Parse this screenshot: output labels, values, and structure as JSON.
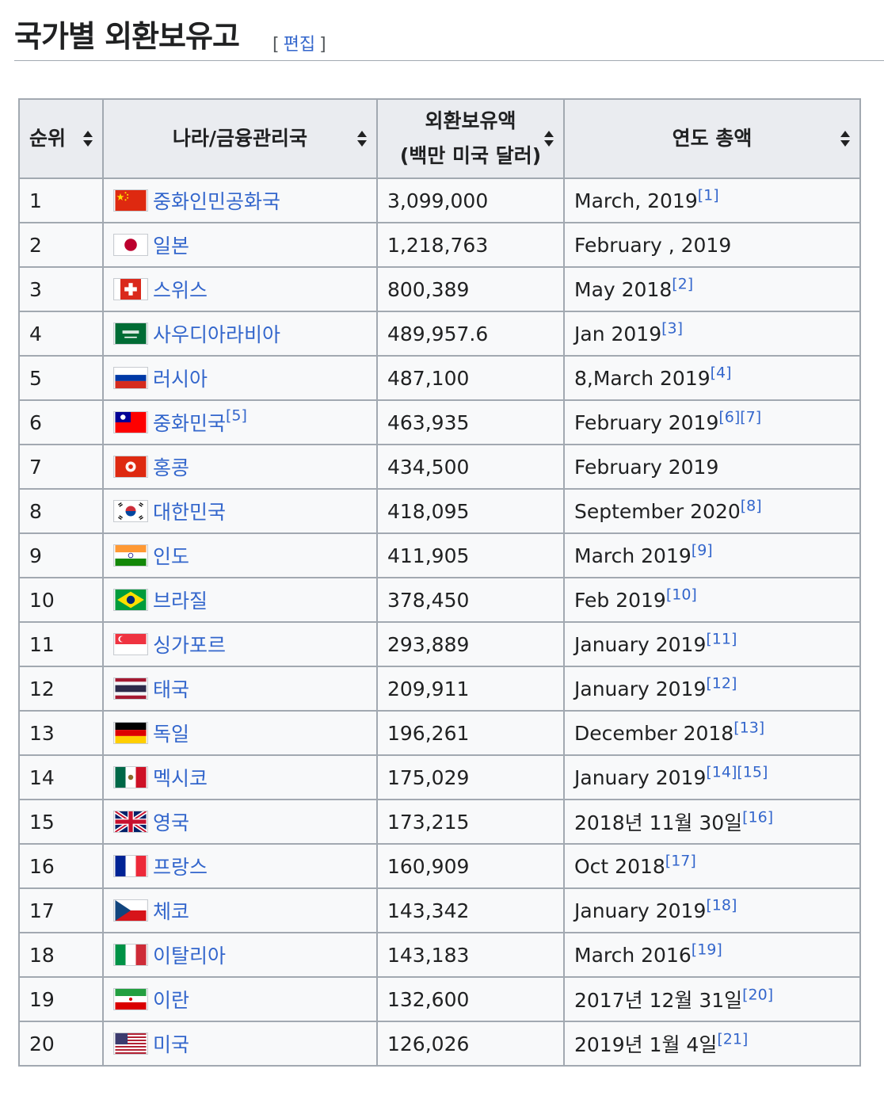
{
  "heading": {
    "title": "국가별 외환보유고",
    "edit_label": "편집",
    "bracket_open": "[",
    "bracket_close": "]"
  },
  "table": {
    "headers": [
      {
        "line1": "순위",
        "line2": ""
      },
      {
        "line1": "나라/금융관리국",
        "line2": ""
      },
      {
        "line1": "외환보유액",
        "line2": "(백만 미국 달러)"
      },
      {
        "line1": "연도 총액",
        "line2": ""
      }
    ],
    "rows": [
      {
        "rank": "1",
        "country": "중화인민공화국",
        "country_ref": "",
        "flag": "flag-china",
        "amount": "3,099,000",
        "date": "March, 2019",
        "refs": "[1]"
      },
      {
        "rank": "2",
        "country": "일본",
        "country_ref": "",
        "flag": "flag-japan",
        "amount": "1,218,763",
        "date": "February , 2019",
        "refs": ""
      },
      {
        "rank": "3",
        "country": "스위스",
        "country_ref": "",
        "flag": "flag-switzerland",
        "amount": "800,389",
        "date": "May 2018",
        "refs": "[2]"
      },
      {
        "rank": "4",
        "country": "사우디아라비아",
        "country_ref": "",
        "flag": "flag-saudi-arabia",
        "amount": "489,957.6",
        "date": "Jan 2019",
        "refs": "[3]"
      },
      {
        "rank": "5",
        "country": "러시아",
        "country_ref": "",
        "flag": "flag-russia",
        "amount": "487,100",
        "date": "8,March 2019",
        "refs": "[4]"
      },
      {
        "rank": "6",
        "country": "중화민국",
        "country_ref": "[5]",
        "flag": "flag-taiwan",
        "amount": "463,935",
        "date": "February 2019",
        "refs": "[6][7]"
      },
      {
        "rank": "7",
        "country": "홍콩",
        "country_ref": "",
        "flag": "flag-hong-kong",
        "amount": "434,500",
        "date": "February 2019",
        "refs": ""
      },
      {
        "rank": "8",
        "country": "대한민국",
        "country_ref": "",
        "flag": "flag-south-korea",
        "amount": "418,095",
        "date": "September 2020",
        "refs": "[8]"
      },
      {
        "rank": "9",
        "country": "인도",
        "country_ref": "",
        "flag": "flag-india",
        "amount": "411,905",
        "date": "March 2019",
        "refs": "[9]"
      },
      {
        "rank": "10",
        "country": "브라질",
        "country_ref": "",
        "flag": "flag-brazil",
        "amount": "378,450",
        "date": "Feb 2019",
        "refs": "[10]"
      },
      {
        "rank": "11",
        "country": "싱가포르",
        "country_ref": "",
        "flag": "flag-singapore",
        "amount": "293,889",
        "date": "January 2019",
        "refs": "[11]"
      },
      {
        "rank": "12",
        "country": "태국",
        "country_ref": "",
        "flag": "flag-thailand",
        "amount": "209,911",
        "date": "January 2019",
        "refs": "[12]"
      },
      {
        "rank": "13",
        "country": "독일",
        "country_ref": "",
        "flag": "flag-germany",
        "amount": "196,261",
        "date": "December 2018",
        "refs": "[13]"
      },
      {
        "rank": "14",
        "country": "멕시코",
        "country_ref": "",
        "flag": "flag-mexico",
        "amount": "175,029",
        "date": "January 2019",
        "refs": "[14][15]"
      },
      {
        "rank": "15",
        "country": "영국",
        "country_ref": "",
        "flag": "flag-united-kingdom",
        "amount": "173,215",
        "date": "2018년 11월 30일",
        "refs": "[16]"
      },
      {
        "rank": "16",
        "country": "프랑스",
        "country_ref": "",
        "flag": "flag-france",
        "amount": "160,909",
        "date": "Oct 2018",
        "refs": "[17]"
      },
      {
        "rank": "17",
        "country": "체코",
        "country_ref": "",
        "flag": "flag-czech",
        "amount": "143,342",
        "date": "January 2019",
        "refs": "[18]"
      },
      {
        "rank": "18",
        "country": "이탈리아",
        "country_ref": "",
        "flag": "flag-italy",
        "amount": "143,183",
        "date": "March 2016",
        "refs": "[19]"
      },
      {
        "rank": "19",
        "country": "이란",
        "country_ref": "",
        "flag": "flag-iran",
        "amount": "132,600",
        "date": "2017년 12월 31일",
        "refs": "[20]"
      },
      {
        "rank": "20",
        "country": "미국",
        "country_ref": "",
        "flag": "flag-usa",
        "amount": "126,026",
        "date": "2019년 1월 4일",
        "refs": "[21]"
      }
    ]
  },
  "colors": {
    "link": "#3366cc",
    "header_bg": "#eaecf0",
    "cell_bg": "#f8f9fa",
    "border": "#a2a9b1"
  }
}
